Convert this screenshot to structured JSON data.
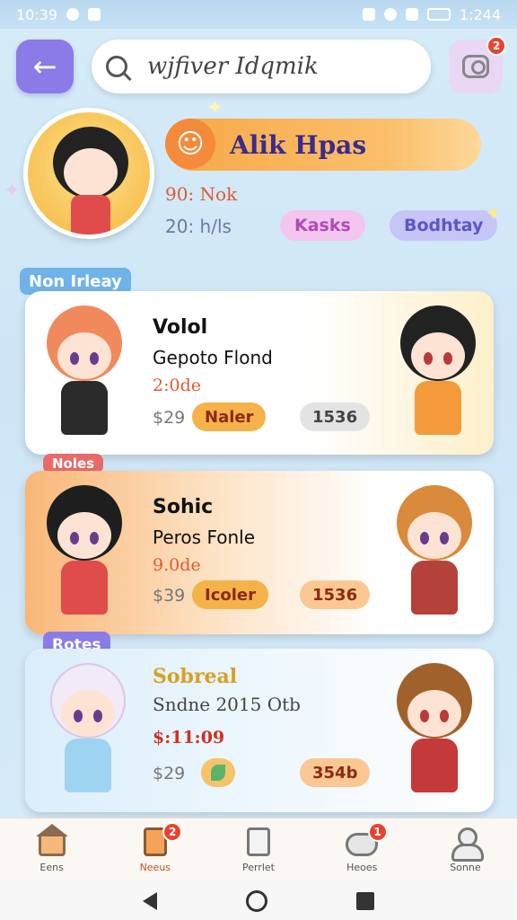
{
  "status_bar": {
    "time_left": "10:39",
    "time_right": "1:244"
  },
  "search": {
    "text": "wjfiver Idqmik"
  },
  "notifications": {
    "badge": "2"
  },
  "profile": {
    "name": "Alik Hpas",
    "stat_1": "90: Nok",
    "stat_2": "20: h/ls",
    "tags": [
      "Kasks",
      "Bodhtay"
    ]
  },
  "sections": [
    {
      "label": "Non Irleay",
      "card": {
        "title": "Volol",
        "subtitle": "Gepoto Flond",
        "date": "2:0de",
        "price": "$29",
        "action": "Naler",
        "count": "1536"
      }
    },
    {
      "label": "Noles",
      "card": {
        "title": "Sohic",
        "subtitle": "Peros Fonle",
        "date": "9.0de",
        "price": "$39",
        "action": "Icoler",
        "count": "1536"
      }
    },
    {
      "label": "Rotes",
      "card": {
        "title": "Sobreal",
        "subtitle": "Sndne 2015 Otb",
        "date": "$:11:09",
        "price": "$29",
        "action_icon": "leaf-icon",
        "count": "354b"
      }
    }
  ],
  "bottom_nav": [
    {
      "label": "Eens",
      "icon": "home-icon",
      "badge": ""
    },
    {
      "label": "Neeus",
      "icon": "document-icon",
      "badge": "2",
      "active": true
    },
    {
      "label": "Perrlet",
      "icon": "list-icon",
      "badge": ""
    },
    {
      "label": "Heoes",
      "icon": "cloud-icon",
      "badge": "1"
    },
    {
      "label": "Sonne",
      "icon": "user-icon",
      "badge": ""
    }
  ],
  "colors": {
    "accent_purple": "#8b7be8",
    "name_pill_orange": "#f7a84a",
    "badge_red": "#e8432e",
    "date_red": "#e05a30"
  }
}
